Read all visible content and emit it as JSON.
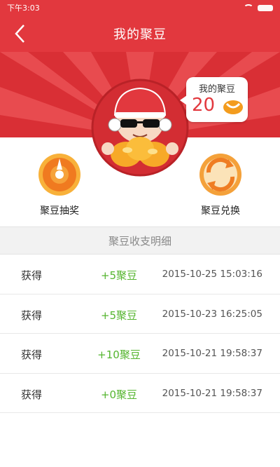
{
  "status_bar": {
    "time": "下午3:03"
  },
  "nav": {
    "title": "我的聚豆"
  },
  "balance": {
    "label": "我的聚豆",
    "count": "20"
  },
  "actions": [
    {
      "label": "聚豆抽奖",
      "icon": "lottery-dial-icon"
    },
    {
      "label": "聚豆兑换",
      "icon": "exchange-icon"
    }
  ],
  "details": {
    "header": "聚豆收支明细",
    "rows": [
      {
        "type": "获得",
        "amount": "+5聚豆",
        "time": "2015-10-25 15:03:16"
      },
      {
        "type": "获得",
        "amount": "+5聚豆",
        "time": "2015-10-23 16:25:05"
      },
      {
        "type": "获得",
        "amount": "+10聚豆",
        "time": "2015-10-21 19:58:37"
      },
      {
        "type": "获得",
        "amount": "+0聚豆",
        "time": "2015-10-21 19:58:37"
      }
    ]
  },
  "colors": {
    "brand_red": "#e2383e",
    "positive_green": "#54b52e",
    "bean_orange": "#f39c1e"
  }
}
